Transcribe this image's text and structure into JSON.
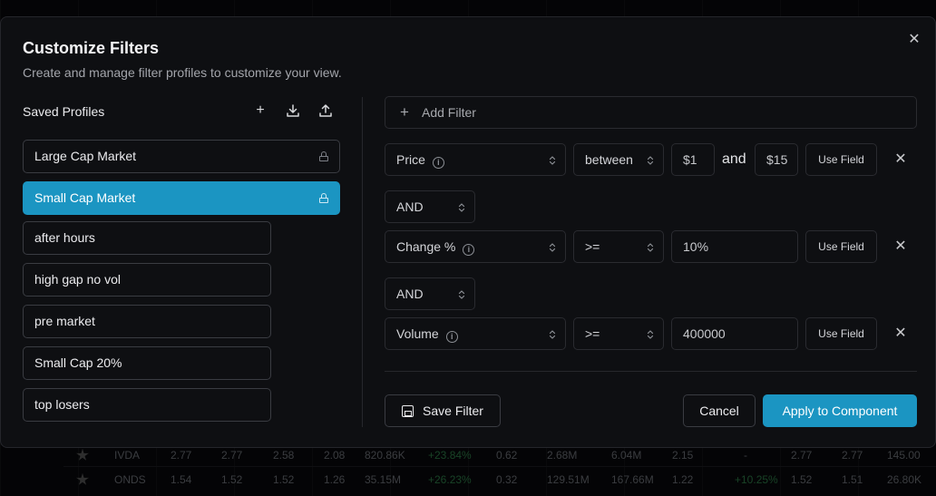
{
  "modal": {
    "title": "Customize Filters",
    "subtitle": "Create and manage filter profiles to customize your view."
  },
  "profiles": {
    "heading": "Saved Profiles",
    "items": [
      {
        "label": "Large Cap Market",
        "locked": true,
        "active": false
      },
      {
        "label": "Small Cap Market",
        "locked": true,
        "active": true
      },
      {
        "label": "after hours",
        "locked": false,
        "active": false
      },
      {
        "label": "high gap no vol",
        "locked": false,
        "active": false
      },
      {
        "label": "pre market",
        "locked": false,
        "active": false
      },
      {
        "label": "Small Cap 20%",
        "locked": false,
        "active": false
      },
      {
        "label": "top losers",
        "locked": false,
        "active": false
      }
    ],
    "icons": [
      "plus-icon",
      "download-icon",
      "upload-icon"
    ]
  },
  "filters": {
    "add_label": "Add Filter",
    "rows": [
      {
        "field": "Price",
        "operator": "between",
        "value": "$1",
        "joiner": "and",
        "value2": "$15",
        "use_field": "Use Field"
      },
      {
        "field": "Change %",
        "operator": ">=",
        "value": "10%",
        "use_field": "Use Field"
      },
      {
        "field": "Volume",
        "operator": ">=",
        "value": "400000",
        "use_field": "Use Field"
      }
    ],
    "logic": [
      "AND",
      "AND"
    ]
  },
  "actions": {
    "save": "Save Filter",
    "cancel": "Cancel",
    "apply": "Apply to Component"
  },
  "background_table": {
    "rows": [
      [
        "IVDA",
        "2.77",
        "2.77",
        "2.58",
        "2.08",
        "820.86K",
        "+23.84%",
        "0.62",
        "2.68M",
        "6.04M",
        "2.15",
        "-",
        "2.77",
        "2.77",
        "145.00"
      ],
      [
        "ONDS",
        "1.54",
        "1.52",
        "1.52",
        "1.26",
        "35.15M",
        "+26.23%",
        "0.32",
        "129.51M",
        "167.66M",
        "1.22",
        "+10.25%",
        "1.52",
        "1.51",
        "26.80K"
      ]
    ]
  },
  "colors": {
    "accent": "#1b95c2",
    "panel": "#0e0f12",
    "border": "#2a2b30"
  }
}
